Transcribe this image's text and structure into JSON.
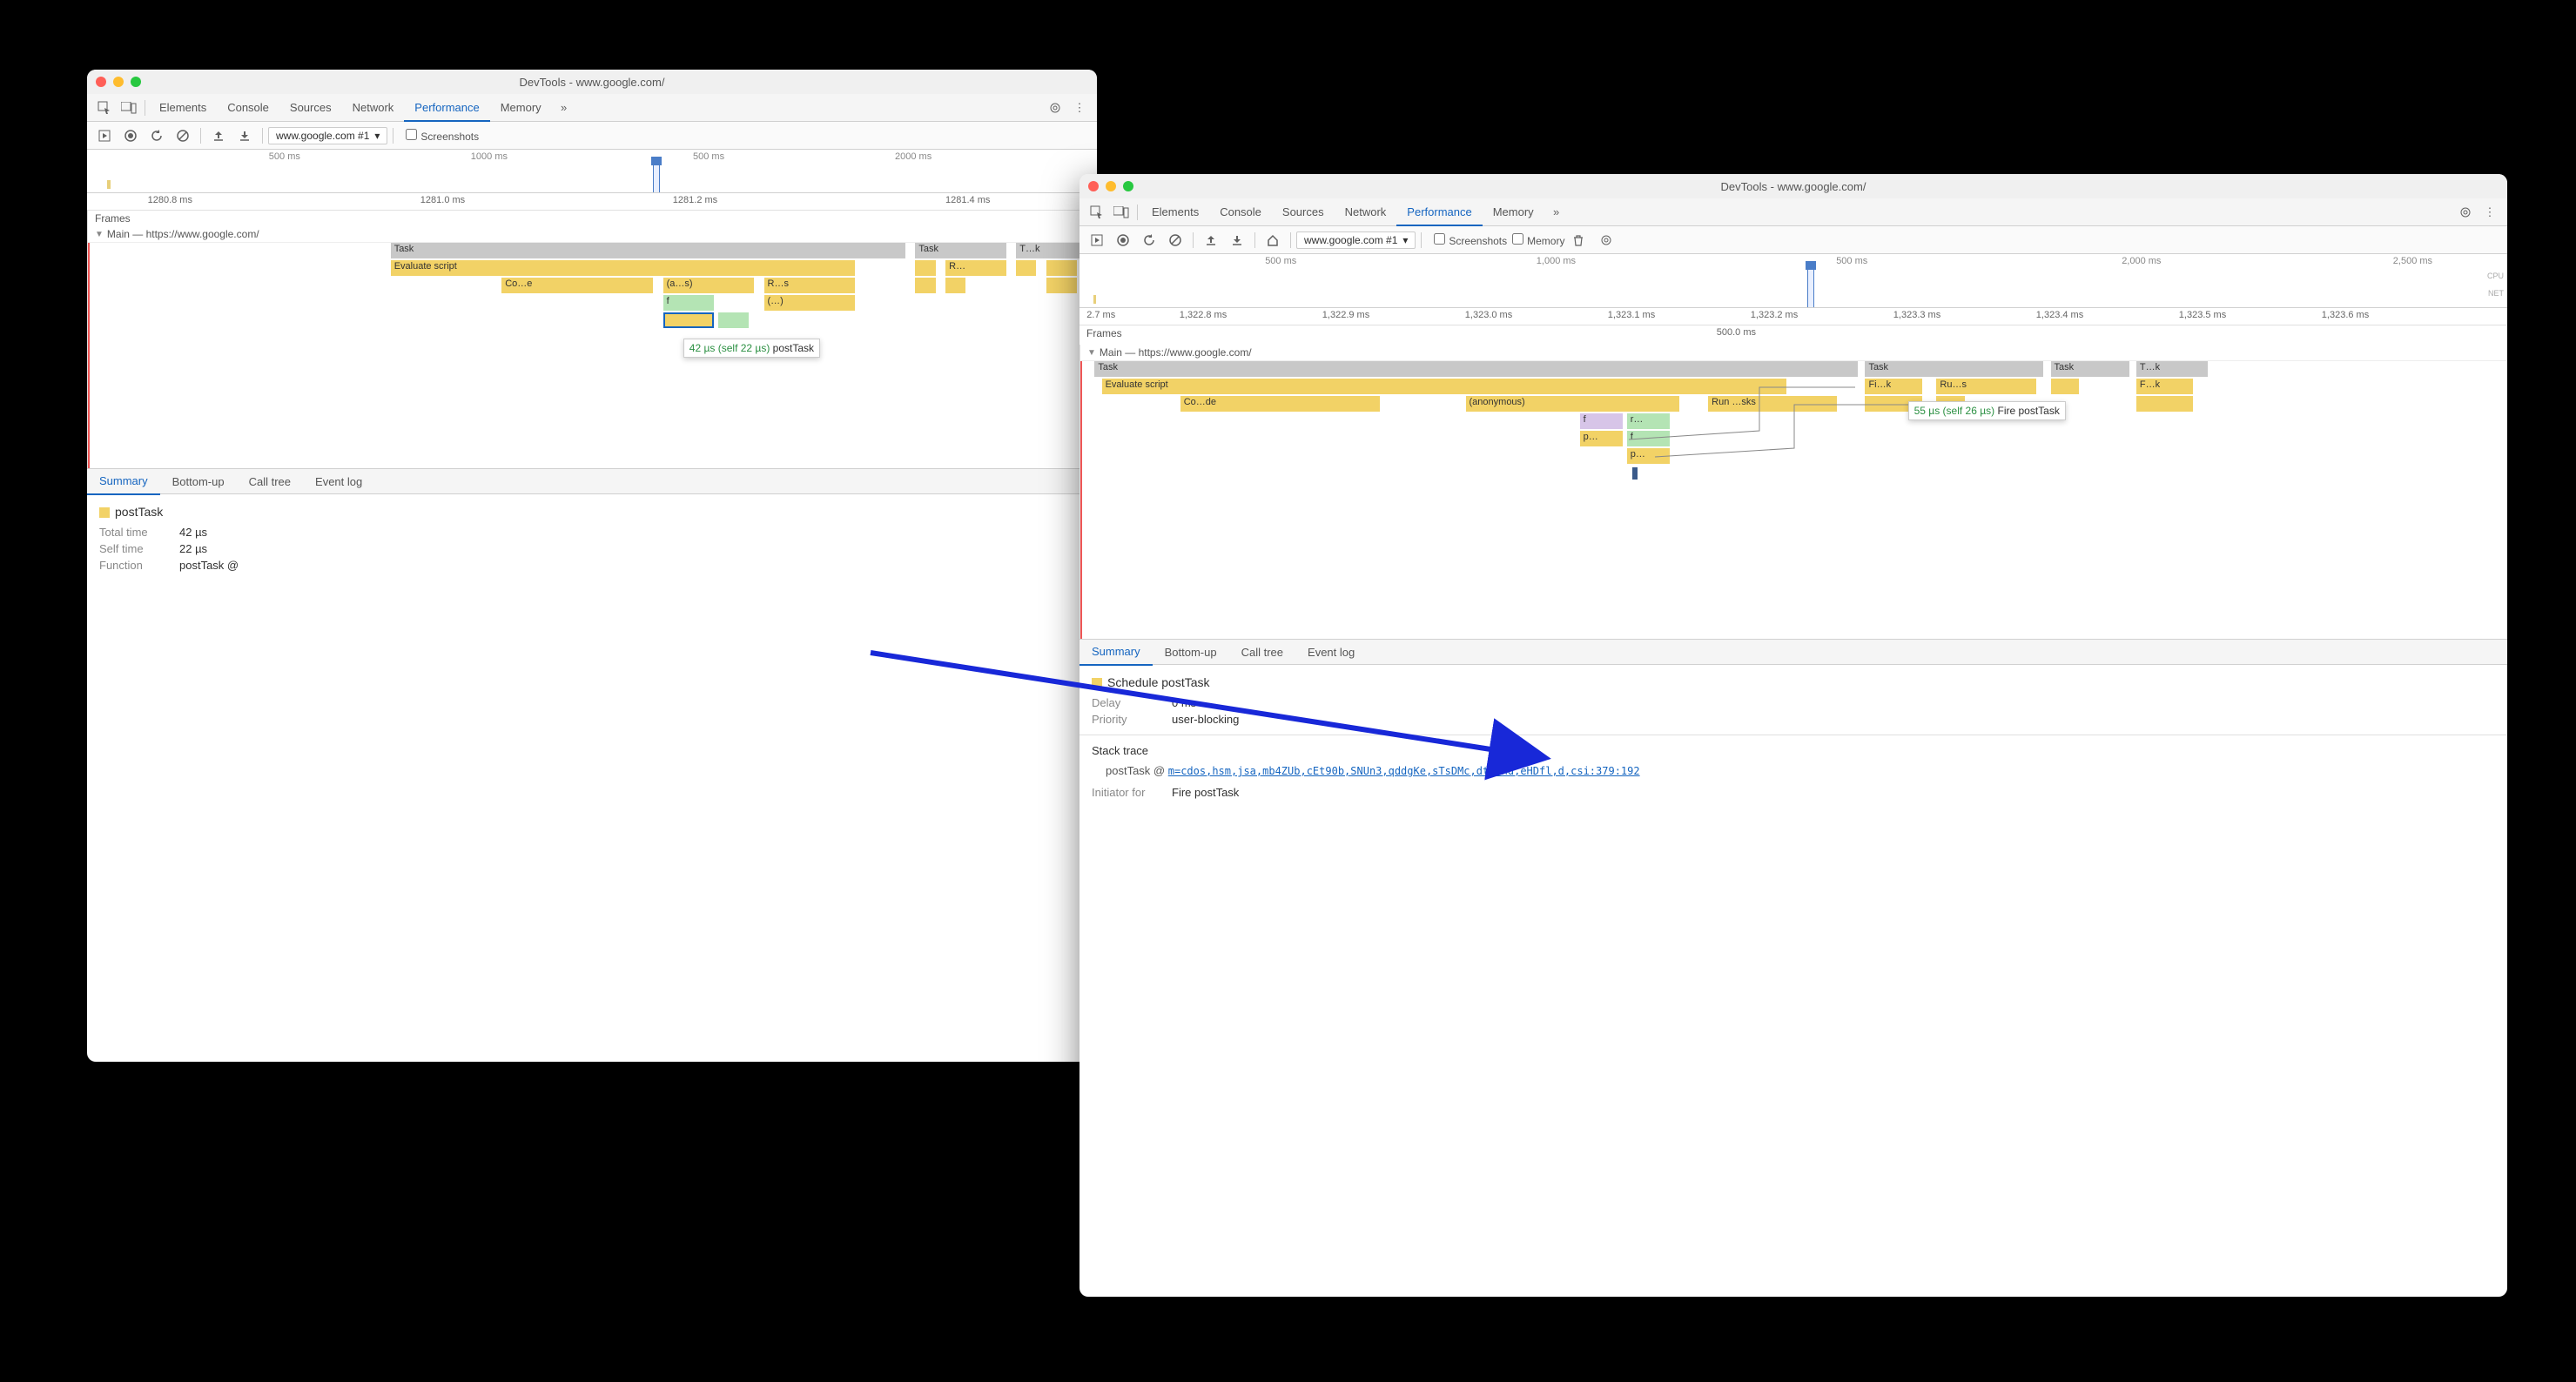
{
  "window_left": {
    "title": "DevTools - www.google.com/",
    "tabs": [
      "Elements",
      "Console",
      "Sources",
      "Network",
      "Performance",
      "Memory"
    ],
    "active_tab": "Performance",
    "toolbar": {
      "select_label": "www.google.com #1",
      "screenshots_label": "Screenshots"
    },
    "overview_ticks": [
      "500 ms",
      "1000 ms",
      "500 ms",
      "2000 ms"
    ],
    "ruler_ticks": [
      "1280.8 ms",
      "1281.0 ms",
      "1281.2 ms",
      "1281.4 ms"
    ],
    "frames_label": "Frames",
    "main_label": "Main — https://www.google.com/",
    "flame": {
      "task1": "Task",
      "task2": "Task",
      "task3": "T…k",
      "eval": "Evaluate script",
      "compile": "Co…e",
      "anon": "(a…s)",
      "run": "R…s",
      "f": "f",
      "paren": "(…)",
      "r_inner": "R…"
    },
    "tooltip": {
      "time": "42 µs (self 22 µs)",
      "name": "postTask"
    },
    "bottom_tabs": [
      "Summary",
      "Bottom-up",
      "Call tree",
      "Event log"
    ],
    "summary": {
      "title": "postTask",
      "total_time_label": "Total time",
      "total_time": "42 µs",
      "self_time_label": "Self time",
      "self_time": "22 µs",
      "function_label": "Function",
      "function": "postTask @"
    }
  },
  "window_right": {
    "title": "DevTools - www.google.com/",
    "tabs": [
      "Elements",
      "Console",
      "Sources",
      "Network",
      "Performance",
      "Memory"
    ],
    "active_tab": "Performance",
    "toolbar": {
      "select_label": "www.google.com #1",
      "screenshots_label": "Screenshots",
      "memory_label": "Memory"
    },
    "overview_ticks": [
      "500 ms",
      "1,000 ms",
      "500 ms",
      "2,000 ms",
      "2,500 ms"
    ],
    "overview_side": [
      "CPU",
      "NET"
    ],
    "ruler_ticks": [
      "2.7 ms",
      "1,322.8 ms",
      "1,322.9 ms",
      "1,323.0 ms",
      "1,323.1 ms",
      "1,323.2 ms",
      "1,323.3 ms",
      "1,323.4 ms",
      "1,323.5 ms",
      "1,323.6 ms"
    ],
    "ruler_center": "500.0 ms",
    "frames_label": "Frames",
    "main_label": "Main — https://www.google.com/",
    "flame": {
      "task1": "Task",
      "task2": "Task",
      "task3": "Task",
      "task4": "T…k",
      "eval": "Evaluate script",
      "compile": "Co…de",
      "anon": "(anonymous)",
      "run": "Run …sks",
      "fire": "Fi…k",
      "runs": "Ru…s",
      "fk": "F…k",
      "f1": "f",
      "r1": "r…",
      "p1": "p…",
      "f2": "f",
      "p2": "p…"
    },
    "tooltip": {
      "time": "55 µs (self 26 µs)",
      "name": "Fire postTask"
    },
    "bottom_tabs": [
      "Summary",
      "Bottom-up",
      "Call tree",
      "Event log"
    ],
    "summary": {
      "title": "Schedule postTask",
      "delay_label": "Delay",
      "delay": "0 ms",
      "priority_label": "Priority",
      "priority": "user-blocking",
      "stack_trace_label": "Stack trace",
      "stack_func": "postTask @",
      "stack_link": "m=cdos,hsm,jsa,mb4ZUb,cEt90b,SNUn3,qddgKe,sTsDMc,dtl0hd,eHDfl,d,csi:379:192",
      "initiator_label": "Initiator for",
      "initiator": "Fire postTask"
    }
  }
}
